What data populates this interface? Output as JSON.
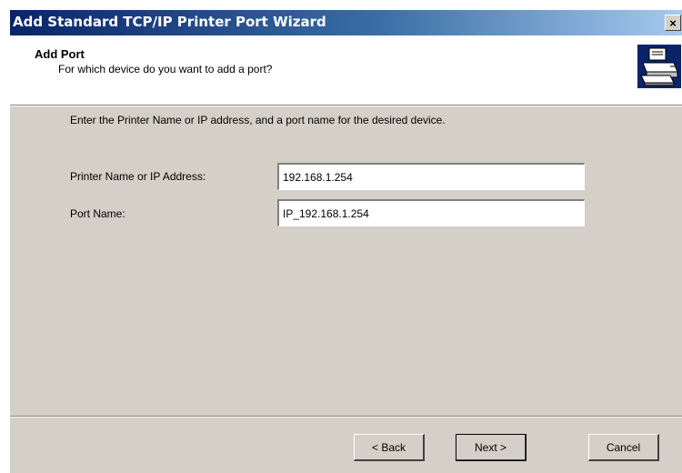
{
  "window": {
    "title": "Add Standard TCP/IP Printer Port Wizard",
    "close_glyph": "×"
  },
  "header": {
    "title": "Add Port",
    "subtitle": "For which device do you want to add a port?",
    "icon": "printer-network-icon"
  },
  "body": {
    "instruction": "Enter the Printer Name or IP address, and a port name for the desired device.",
    "printer_field": {
      "label": "Printer Name or IP Address:",
      "value": "192.168.1.254"
    },
    "port_field": {
      "label": "Port Name:",
      "value": "IP_192.168.1.254"
    }
  },
  "footer": {
    "back_label": "< Back",
    "next_label": "Next >",
    "cancel_label": "Cancel"
  },
  "colors": {
    "dialog_face": "#d4d0c8",
    "title_gradient_start": "#0a246a",
    "title_gradient_end": "#a6caf0"
  }
}
